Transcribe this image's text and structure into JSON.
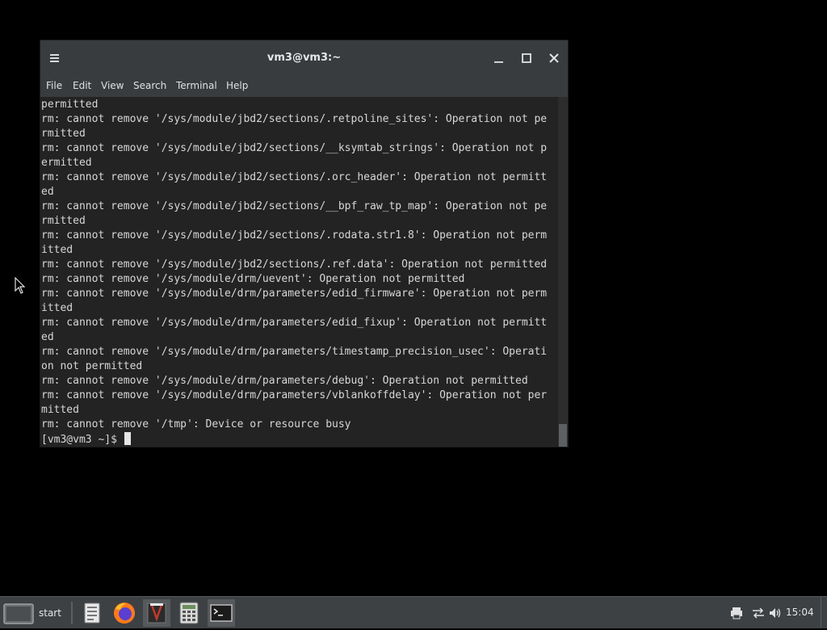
{
  "window": {
    "title": "vm3@vm3:~",
    "menu_icon": "hamburger-icon",
    "controls": [
      "minimize-icon",
      "maximize-icon",
      "close-icon"
    ]
  },
  "menubar": [
    "File",
    "Edit",
    "View",
    "Search",
    "Terminal",
    "Help"
  ],
  "terminal": {
    "lines": [
      "permitted",
      "rm: cannot remove '/sys/module/jbd2/sections/.retpoline_sites': Operation not pe",
      "rmitted",
      "rm: cannot remove '/sys/module/jbd2/sections/__ksymtab_strings': Operation not p",
      "ermitted",
      "rm: cannot remove '/sys/module/jbd2/sections/.orc_header': Operation not permitt",
      "ed",
      "rm: cannot remove '/sys/module/jbd2/sections/__bpf_raw_tp_map': Operation not pe",
      "rmitted",
      "rm: cannot remove '/sys/module/jbd2/sections/.rodata.str1.8': Operation not perm",
      "itted",
      "rm: cannot remove '/sys/module/jbd2/sections/.ref.data': Operation not permitted",
      "rm: cannot remove '/sys/module/drm/uevent': Operation not permitted",
      "rm: cannot remove '/sys/module/drm/parameters/edid_firmware': Operation not perm",
      "itted",
      "rm: cannot remove '/sys/module/drm/parameters/edid_fixup': Operation not permitt",
      "ed",
      "rm: cannot remove '/sys/module/drm/parameters/timestamp_precision_usec': Operati",
      "on not permitted",
      "rm: cannot remove '/sys/module/drm/parameters/debug': Operation not permitted",
      "rm: cannot remove '/sys/module/drm/parameters/vblankoffdelay': Operation not per",
      "mitted",
      "rm: cannot remove '/tmp': Device or resource busy"
    ],
    "prompt": "[vm3@vm3 ~]$ "
  },
  "taskbar": {
    "start_label": "start",
    "launchers": [
      "file-manager-icon",
      "firefox-icon",
      "text-editor-icon",
      "calculator-icon",
      "terminal-icon"
    ],
    "tray_icons": [
      "printer-icon",
      "network-icon",
      "volume-icon"
    ],
    "clock": "15:04"
  },
  "colors": {
    "titlebar": "#383c3f",
    "terminal_bg": "#232323",
    "terminal_fg": "#d7d7d7",
    "taskbar": "#3d4144",
    "desktop": "#000000"
  }
}
